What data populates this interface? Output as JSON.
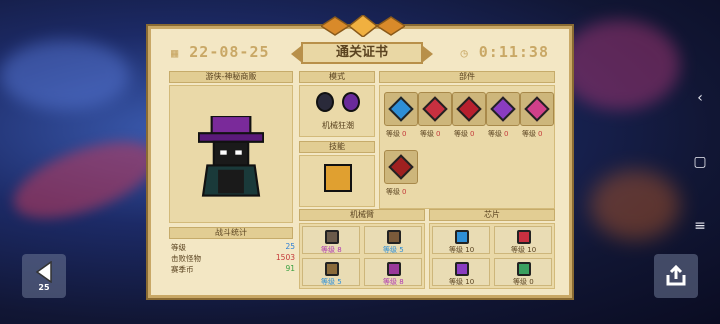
{
  "certificate": {
    "date": "22-08-25",
    "title": "通关证书",
    "time": "0:11:38"
  },
  "character": {
    "name": "游侠-神秘商贩"
  },
  "mode": {
    "header": "模式",
    "label": "机械狂潮"
  },
  "skill": {
    "header": "技能"
  },
  "parts": {
    "header": "部件",
    "items": [
      {
        "label": "等级",
        "level": "0",
        "color": "#2e8fd6"
      },
      {
        "label": "等级",
        "level": "0",
        "color": "#c83040"
      },
      {
        "label": "等级",
        "level": "0",
        "color": "#b8202e"
      },
      {
        "label": "等级",
        "level": "0",
        "color": "#8a3cc0"
      },
      {
        "label": "等级",
        "level": "0",
        "color": "#d0408a"
      },
      {
        "label": "等级",
        "level": "0",
        "color": "#a02020"
      }
    ]
  },
  "battle_stats": {
    "header": "战斗统计",
    "rows": [
      {
        "label": "等级",
        "value": "25",
        "color": "#2e7fd6"
      },
      {
        "label": "击败怪物",
        "value": "1503",
        "color": "#c43a3a"
      },
      {
        "label": "赛季币",
        "value": "91",
        "color": "#3aa040"
      }
    ]
  },
  "mecha_arm": {
    "header": "机械臂",
    "items": [
      {
        "label": "等级",
        "level": "8",
        "color": "#b03ab0"
      },
      {
        "label": "等级",
        "level": "5",
        "color": "#2e8fd6"
      },
      {
        "label": "等级",
        "level": "5",
        "color": "#2e8fd6"
      },
      {
        "label": "等级",
        "level": "8",
        "color": "#b03ab0"
      }
    ]
  },
  "chips": {
    "header": "芯片",
    "items": [
      {
        "label": "等级",
        "level": "10",
        "color": "#2e8fd6"
      },
      {
        "label": "等级",
        "level": "10",
        "color": "#c83040"
      },
      {
        "label": "等级",
        "level": "10",
        "color": "#8a3cc0"
      },
      {
        "label": "等级",
        "level": "0",
        "color": "#3aa060"
      }
    ]
  },
  "nav": {
    "back_count": "25"
  },
  "icons": [
    "calendar-icon",
    "clock-icon",
    "back-arrow-icon",
    "share-icon",
    "menu-icon",
    "home-icon",
    "recent-icon"
  ]
}
